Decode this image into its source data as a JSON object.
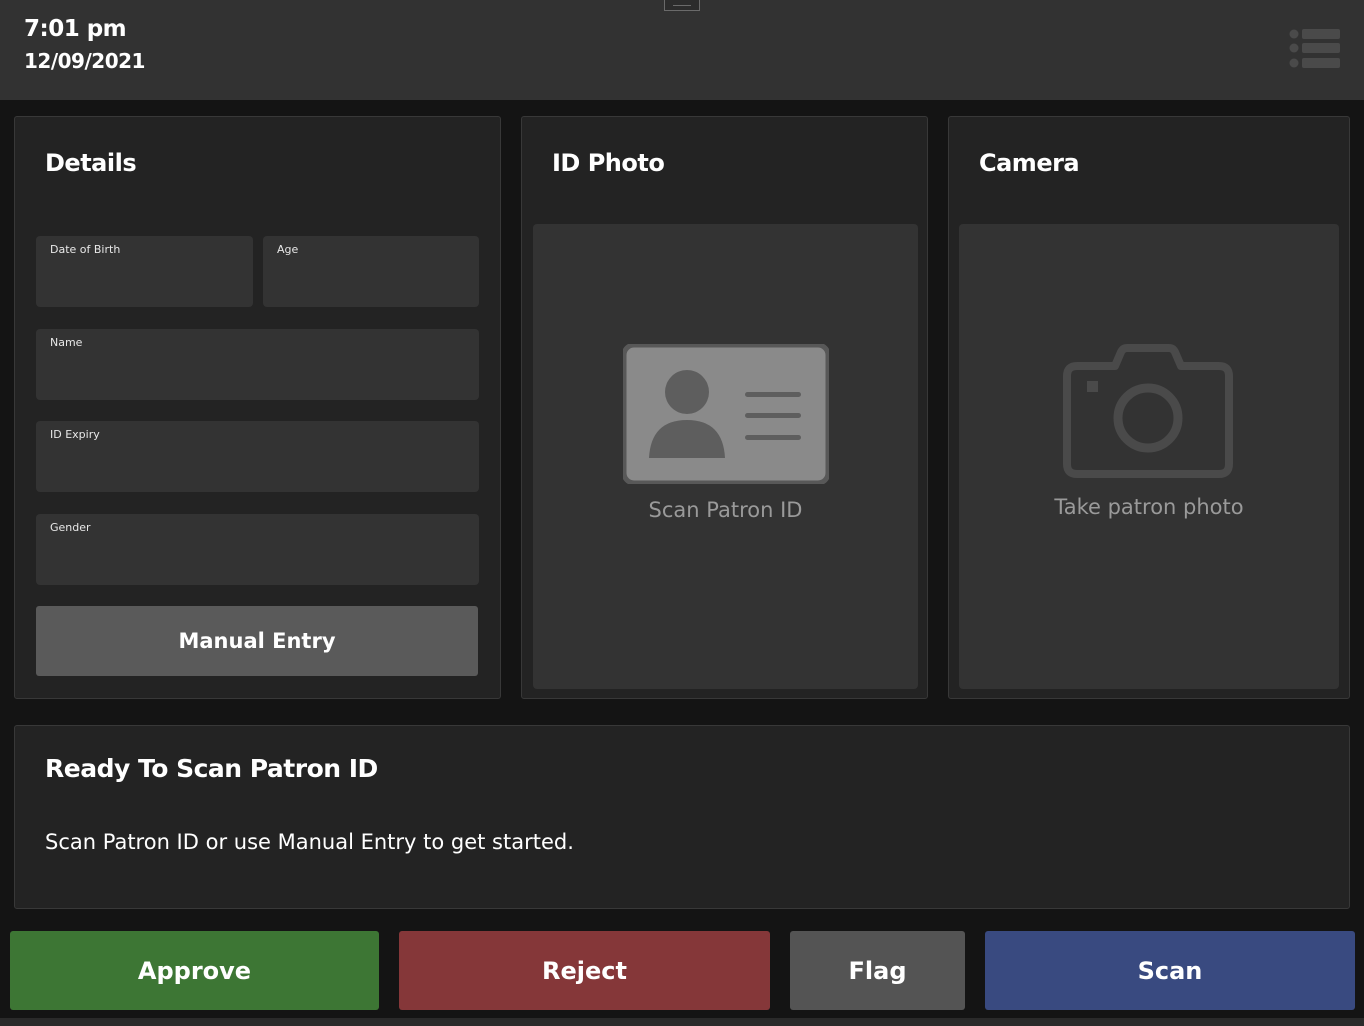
{
  "header": {
    "time": "7:01 pm",
    "date": "12/09/2021",
    "menu_icon": "list-menu-icon"
  },
  "details": {
    "title": "Details",
    "fields": {
      "dob": {
        "label": "Date of Birth",
        "value": ""
      },
      "age": {
        "label": "Age",
        "value": ""
      },
      "name": {
        "label": "Name",
        "value": ""
      },
      "id_expiry": {
        "label": "ID Expiry",
        "value": ""
      },
      "gender": {
        "label": "Gender",
        "value": ""
      }
    },
    "manual_entry_label": "Manual Entry"
  },
  "id_photo": {
    "title": "ID Photo",
    "caption": "Scan Patron ID",
    "icon": "id-card-icon"
  },
  "camera": {
    "title": "Camera",
    "caption": "Take patron photo",
    "icon": "camera-icon"
  },
  "status": {
    "title": "Ready To Scan Patron ID",
    "message": "Scan Patron ID or use Manual Entry to get started."
  },
  "actions": {
    "approve": "Approve",
    "reject": "Reject",
    "flag": "Flag",
    "scan": "Scan"
  },
  "colors": {
    "approve": "#3d7634",
    "reject": "#853739",
    "flag": "#545454",
    "scan": "#394a80",
    "panel": "#232323",
    "field": "#333333"
  }
}
